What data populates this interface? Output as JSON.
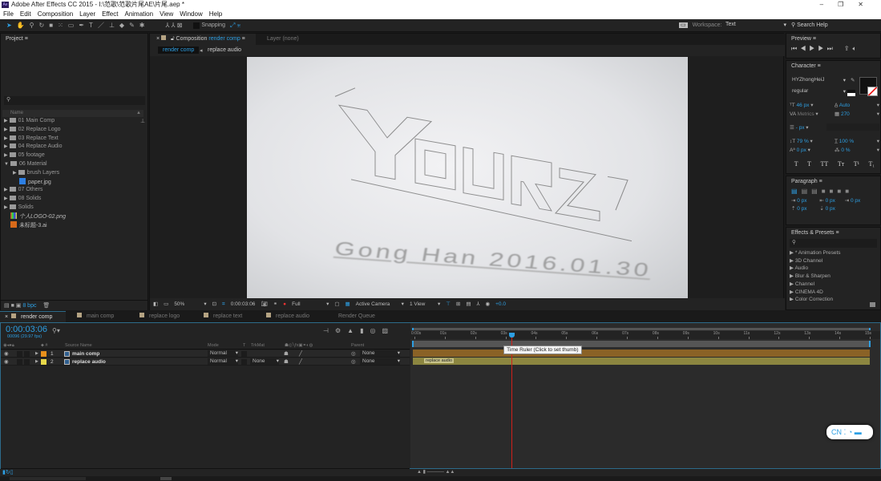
{
  "app": {
    "title": "Adobe After Effects CC 2015 - I:\\范歌\\范歌片尾AE\\片尾.aep *",
    "logo": "Ae"
  },
  "menu": [
    "File",
    "Edit",
    "Composition",
    "Layer",
    "Effect",
    "Animation",
    "View",
    "Window",
    "Help"
  ],
  "toolbar": {
    "snapping": "Snapping",
    "workspace_label": "Workspace:",
    "workspace_value": "Text",
    "search_help": "Search Help"
  },
  "project": {
    "title": "Project",
    "column_name": "Name",
    "bpc": "8 bpc",
    "items": [
      {
        "label": "01 Main Comp",
        "type": "folder",
        "indent": 0,
        "open": false
      },
      {
        "label": "02 Replace Logo",
        "type": "folder",
        "indent": 0,
        "open": false
      },
      {
        "label": "03 Replace Text",
        "type": "folder",
        "indent": 0,
        "open": false
      },
      {
        "label": "04 Replace Audio",
        "type": "folder",
        "indent": 0,
        "open": false
      },
      {
        "label": "05 footage",
        "type": "folder",
        "indent": 0,
        "open": false
      },
      {
        "label": "06 Material",
        "type": "folder",
        "indent": 0,
        "open": true
      },
      {
        "label": "brush Layers",
        "type": "folder",
        "indent": 1,
        "open": false
      },
      {
        "label": "paper.jpg",
        "type": "image",
        "indent": 1
      },
      {
        "label": "07 Others",
        "type": "folder",
        "indent": 0,
        "open": false
      },
      {
        "label": "08 Solids",
        "type": "folder",
        "indent": 0,
        "open": false
      },
      {
        "label": "Solids",
        "type": "folder",
        "indent": 0,
        "open": false
      },
      {
        "label": "个人LOGO-02.png",
        "type": "png",
        "indent": 0
      },
      {
        "label": "未标题-3.ai",
        "type": "ai",
        "indent": 0
      }
    ]
  },
  "composition": {
    "tab_prefix": "Composition",
    "tab_name": "render comp",
    "layer_tab": "Layer (none)",
    "breadcrumbs": [
      "render comp",
      "replace audio"
    ],
    "logo_text": "YOURZ",
    "sub_text": "Gong Han 2016.01.30",
    "viewer": {
      "zoom": "50%",
      "timecode": "0:00:03:06",
      "resolution": "Full",
      "camera": "Active Camera",
      "views": "1 View",
      "exposure": "+0.0"
    }
  },
  "preview": {
    "title": "Preview"
  },
  "character": {
    "title": "Character",
    "font": "HYZhongHeiJ",
    "style": "regular",
    "size": "46 px",
    "leading": "Auto",
    "kerning": "Metrics",
    "tracking": "270",
    "stroke": "- px",
    "vscale": "79 %",
    "hscale": "100 %",
    "baseline": "0 px",
    "tsume": "0 %",
    "styles": [
      "T",
      "T",
      "TT",
      "Tт",
      "T¹",
      "T₁"
    ]
  },
  "paragraph": {
    "title": "Paragraph",
    "indents": [
      "0 px",
      "0 px",
      "0 px",
      "0 px",
      "0 px"
    ]
  },
  "effects": {
    "title": "Effects & Presets",
    "items": [
      "* Animation Presets",
      "3D Channel",
      "Audio",
      "Blur & Sharpen",
      "Channel",
      "CINEMA 4D",
      "Color Correction"
    ]
  },
  "timeline": {
    "tabs": [
      "render comp",
      "main comp",
      "replace logo",
      "replace text",
      "replace audio",
      "Render Queue"
    ],
    "timecode": "0:00:03:06",
    "frames": "00096 (29.97 fps)",
    "columns": {
      "source": "Source Name",
      "mode": "Mode",
      "t": "T",
      "trkmat": "TrkMat",
      "parent": "Parent"
    },
    "layers": [
      {
        "num": "1",
        "name": "main comp",
        "color": "#e8901c",
        "mode": "Normal",
        "trkmat": "",
        "parent": "None",
        "bar": "#8a6226"
      },
      {
        "num": "2",
        "name": "replace audio",
        "color": "#e8d84a",
        "mode": "Normal",
        "trkmat": "None",
        "parent": "None",
        "bar": "#8c8640"
      }
    ],
    "ruler": [
      "0:00s",
      "01s",
      "02s",
      "03s",
      "04s",
      "05s",
      "06s",
      "07s",
      "08s",
      "09s",
      "10s",
      "11s",
      "12s",
      "13s",
      "14s",
      "15s"
    ],
    "playhead_seconds": 3.2,
    "duration_seconds": 15,
    "tooltip": "Time Ruler (Click to set thumb)",
    "bar_label": "replace audio"
  },
  "ime": {
    "label": "CN"
  },
  "colors": {
    "accent": "#2d9fe3",
    "playhead": "#d0201a",
    "panel": "#232323"
  }
}
